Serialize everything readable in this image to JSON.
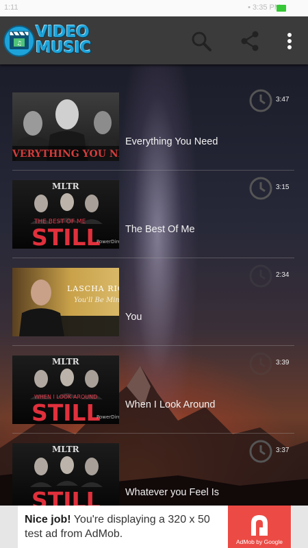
{
  "status": {
    "left_text": "1:11",
    "right_text": "• 3:35 PM"
  },
  "app": {
    "logo_line1": "VIDEO",
    "logo_line2": "MUSIC"
  },
  "toolbar": {
    "icons": [
      "search-icon",
      "share-icon",
      "more-vert-icon"
    ]
  },
  "songs": [
    {
      "title": "Everything You Need",
      "duration": "3:47",
      "thumb_caption": "VERYTHING YOU NEE",
      "thumb_style": "bw-band"
    },
    {
      "title": "The Best Of Me",
      "duration": "3:15",
      "thumb_header": "MLTR",
      "thumb_sub": "THE BEST OF ME",
      "thumb_big": "STILL",
      "thumb_credit": "PowerDirec",
      "thumb_style": "still"
    },
    {
      "title": "You",
      "duration": "2:34",
      "thumb_name": "LASCHA RICHT",
      "thumb_sub": "You'll Be Mine",
      "thumb_style": "gold"
    },
    {
      "title": "When I Look Around",
      "duration": "3:39",
      "thumb_header": "MLTR",
      "thumb_sub": "WHEN I LOOK AROUND",
      "thumb_big": "STILL",
      "thumb_credit": "PowerDirec",
      "thumb_style": "still"
    },
    {
      "title": "Whatever you Feel Is",
      "duration": "3:37",
      "thumb_header": "MLTR",
      "thumb_sub": "",
      "thumb_big": "STILL",
      "thumb_credit": "",
      "thumb_style": "still"
    }
  ],
  "ad": {
    "bold": "Nice job!",
    "text": " You're displaying a 320 x 50 test ad from AdMob.",
    "badge": "AdMob by Google"
  },
  "colors": {
    "toolbar": "#3b3b3b",
    "logo_blue": "#1da3da",
    "ad_red": "#ec4b45",
    "battery": "#37c837"
  }
}
